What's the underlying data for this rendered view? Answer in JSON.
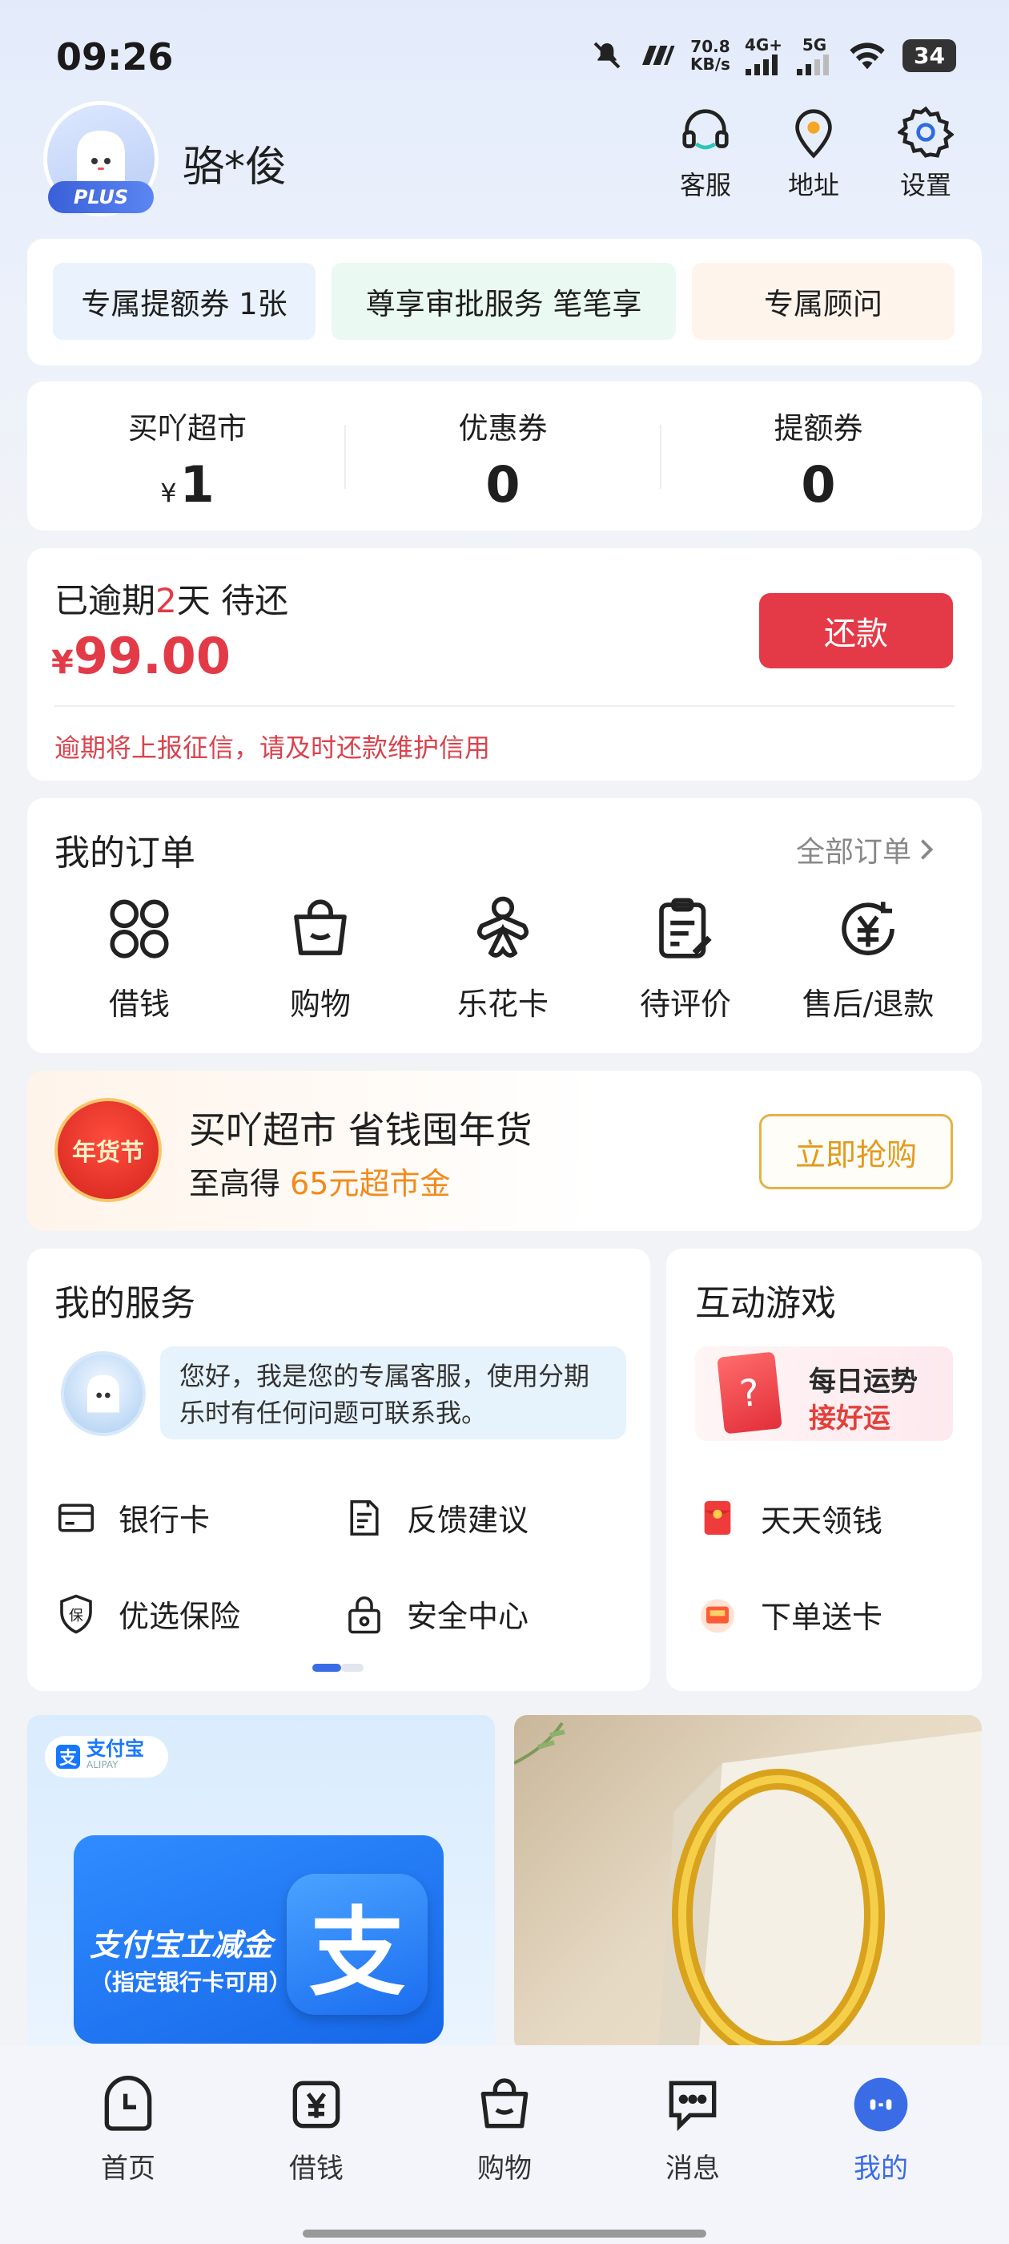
{
  "status_bar": {
    "time": "09:26",
    "net_speed_value": "70.8",
    "net_speed_unit": "KB/s",
    "network_1": "4G+",
    "network_2": "5G",
    "battery": "34"
  },
  "header": {
    "user_name": "骆*俊",
    "badge": "PLUS",
    "actions": [
      {
        "label": "客服",
        "icon": "headset-icon"
      },
      {
        "label": "地址",
        "icon": "location-pin-icon"
      },
      {
        "label": "设置",
        "icon": "gear-icon"
      }
    ]
  },
  "perks": [
    {
      "label": "专属提额券 1张",
      "bg": "#eaf3fd"
    },
    {
      "label": "尊享审批服务 笔笔享",
      "bg": "#eafaf1"
    },
    {
      "label": "专属顾问",
      "bg": "#fff3ea"
    }
  ],
  "stats": [
    {
      "label": "买吖超市",
      "prefix": "¥",
      "value": "1"
    },
    {
      "label": "优惠券",
      "prefix": "",
      "value": "0"
    },
    {
      "label": "提额券",
      "prefix": "",
      "value": "0"
    }
  ],
  "overdue": {
    "title_pre": "已逾期",
    "days": "2",
    "title_post": "天 待还",
    "currency": "¥",
    "amount": "99.00",
    "button": "还款",
    "warning": "逾期将上报征信，请及时还款维护信用"
  },
  "orders": {
    "title": "我的订单",
    "see_all": "全部订单",
    "items": [
      {
        "label": "借钱",
        "icon": "four-leaf-icon"
      },
      {
        "label": "购物",
        "icon": "shopping-bag-icon"
      },
      {
        "label": "乐花卡",
        "icon": "flower-icon"
      },
      {
        "label": "待评价",
        "icon": "clipboard-edit-icon"
      },
      {
        "label": "售后/退款",
        "icon": "yen-refund-icon"
      }
    ]
  },
  "promo": {
    "badge": "年货节",
    "title": "买吖超市 省钱囤年货",
    "sub_pre": "至高得",
    "sub_highlight": "65元超市金",
    "button": "立即抢购"
  },
  "services": {
    "title": "我的服务",
    "cs_message": "您好，我是您的专属客服，使用分期乐时有任何问题可联系我。",
    "items": [
      {
        "label": "银行卡",
        "icon": "bank-card-icon"
      },
      {
        "label": "反馈建议",
        "icon": "feedback-icon"
      },
      {
        "label": "优选保险",
        "icon": "insurance-shield-icon"
      },
      {
        "label": "安全中心",
        "icon": "lock-icon"
      }
    ]
  },
  "games": {
    "title": "互动游戏",
    "fortune_line1": "每日运势",
    "fortune_line2": "接好运",
    "fortune_card": "?",
    "items": [
      {
        "label": "天天领钱",
        "icon": "red-envelope-icon"
      },
      {
        "label": "下单送卡",
        "icon": "gift-card-icon"
      }
    ]
  },
  "banners": {
    "alipay_tag": "支付宝",
    "alipay_tag_sub": "ALIPAY",
    "alipay_logo": "支",
    "alipay_text1": "支付宝立减金",
    "alipay_text2": "（指定银行卡可用）"
  },
  "tabbar": [
    {
      "label": "首页",
      "icon": "clock-home-icon"
    },
    {
      "label": "借钱",
      "icon": "yen-icon"
    },
    {
      "label": "购物",
      "icon": "shopping-bag-icon"
    },
    {
      "label": "消息",
      "icon": "chat-bubble-icon"
    },
    {
      "label": "我的",
      "icon": "profile-face-icon",
      "active": true
    }
  ],
  "colors": {
    "accent_blue": "#3a6ce6",
    "alert_red": "#e33a47",
    "promo_orange": "#f28a1c"
  }
}
